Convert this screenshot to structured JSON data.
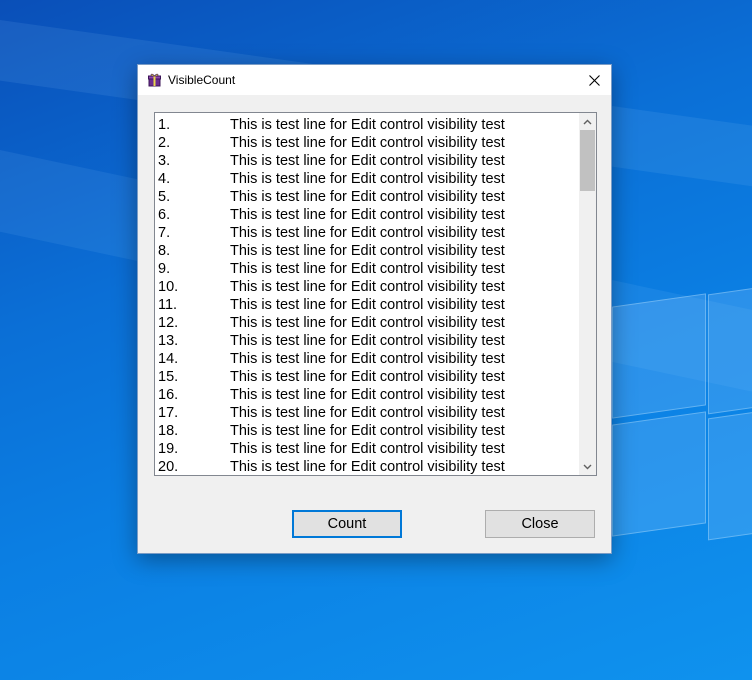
{
  "window": {
    "title": "VisibleCount"
  },
  "editbox": {
    "lines": [
      {
        "num": "1.",
        "text": "This is test line for Edit control visibility test"
      },
      {
        "num": "2.",
        "text": "This is test line for Edit control visibility test"
      },
      {
        "num": "3.",
        "text": "This is test line for Edit control visibility test"
      },
      {
        "num": "4.",
        "text": "This is test line for Edit control visibility test"
      },
      {
        "num": "5.",
        "text": "This is test line for Edit control visibility test"
      },
      {
        "num": "6.",
        "text": "This is test line for Edit control visibility test"
      },
      {
        "num": "7.",
        "text": "This is test line for Edit control visibility test"
      },
      {
        "num": "8.",
        "text": "This is test line for Edit control visibility test"
      },
      {
        "num": "9.",
        "text": "This is test line for Edit control visibility test"
      },
      {
        "num": "10.",
        "text": "This is test line for Edit control visibility test"
      },
      {
        "num": "11.",
        "text": "This is test line for Edit control visibility test"
      },
      {
        "num": "12.",
        "text": "This is test line for Edit control visibility test"
      },
      {
        "num": "13.",
        "text": "This is test line for Edit control visibility test"
      },
      {
        "num": "14.",
        "text": "This is test line for Edit control visibility test"
      },
      {
        "num": "15.",
        "text": "This is test line for Edit control visibility test"
      },
      {
        "num": "16.",
        "text": "This is test line for Edit control visibility test"
      },
      {
        "num": "17.",
        "text": "This is test line for Edit control visibility test"
      },
      {
        "num": "18.",
        "text": "This is test line for Edit control visibility test"
      },
      {
        "num": "19.",
        "text": "This is test line for Edit control visibility test"
      },
      {
        "num": "20.",
        "text": "This is test line for Edit control visibility test"
      }
    ]
  },
  "buttons": {
    "count_label": "Count",
    "close_label": "Close"
  },
  "icons": {
    "app": "gift-icon",
    "close": "close-icon",
    "scroll_up": "chevron-up-icon",
    "scroll_down": "chevron-down-icon"
  },
  "colors": {
    "accent": "#0078d7",
    "desktop": "#0b6fd6"
  }
}
